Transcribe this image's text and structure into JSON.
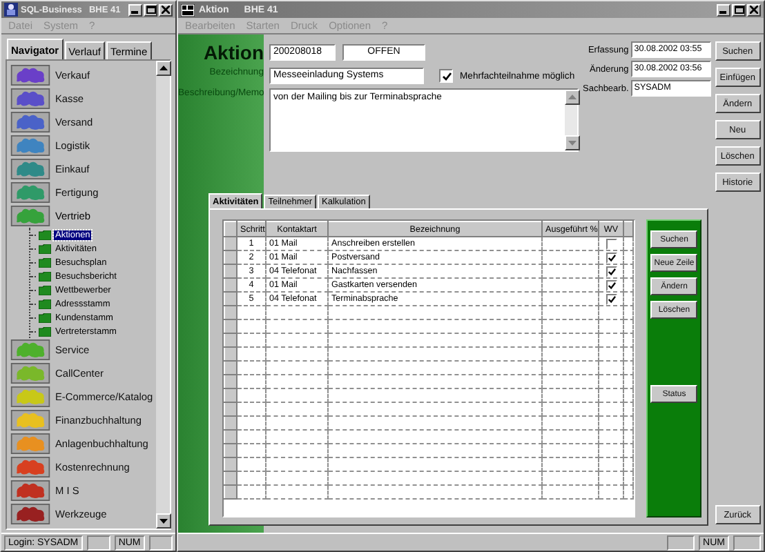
{
  "nav_window": {
    "title": "SQL-Business",
    "title_extra": "BHE 41",
    "menu": [
      "Datei",
      "System",
      "?"
    ],
    "tabs": [
      {
        "label": "Navigator",
        "selected": true
      },
      {
        "label": "Verlauf",
        "selected": false
      },
      {
        "label": "Termine",
        "selected": false
      }
    ],
    "items": [
      {
        "label": "Verkauf",
        "color": "#6a3fc8",
        "expanded": false
      },
      {
        "label": "Kasse",
        "color": "#5a4fc8",
        "expanded": false
      },
      {
        "label": "Versand",
        "color": "#4a62c8",
        "expanded": false
      },
      {
        "label": "Logistik",
        "color": "#3f84c0",
        "expanded": false
      },
      {
        "label": "Einkauf",
        "color": "#2f8a88",
        "expanded": false
      },
      {
        "label": "Fertigung",
        "color": "#2f9a68",
        "expanded": false
      },
      {
        "label": "Vertrieb",
        "color": "#36a23c",
        "expanded": true,
        "children": [
          {
            "label": "Aktionen",
            "selected": true
          },
          {
            "label": "Aktivitäten",
            "selected": false
          },
          {
            "label": "Besuchsplan",
            "selected": false
          },
          {
            "label": "Besuchsbericht",
            "selected": false
          },
          {
            "label": "Wettbewerber",
            "selected": false
          },
          {
            "label": "Adressstamm",
            "selected": false
          },
          {
            "label": "Kundenstamm",
            "selected": false
          },
          {
            "label": "Vertreterstamm",
            "selected": false
          }
        ]
      },
      {
        "label": "Service",
        "color": "#4eb02c",
        "expanded": false
      },
      {
        "label": "CallCenter",
        "color": "#7ab82a",
        "expanded": false
      },
      {
        "label": "E-Commerce/Katalog",
        "color": "#c8c818",
        "expanded": false
      },
      {
        "label": "Finanzbuchhaltung",
        "color": "#e8c020",
        "expanded": false
      },
      {
        "label": "Anlagenbuchhaltung",
        "color": "#e89020",
        "expanded": false
      },
      {
        "label": "Kostenrechnung",
        "color": "#d84020",
        "expanded": false
      },
      {
        "label": "M I S",
        "color": "#c03020",
        "expanded": false
      },
      {
        "label": "Werkzeuge",
        "color": "#982020",
        "expanded": false
      }
    ],
    "status": {
      "login": "Login: SYSADM",
      "num": "NUM"
    }
  },
  "detail_window": {
    "title": "Aktion",
    "title_extra": "BHE 41",
    "menu": [
      "Bearbeiten",
      "Starten",
      "Druck",
      "Optionen",
      "?"
    ],
    "form": {
      "heading": "Aktion",
      "number": "200208018",
      "status": "OFFEN",
      "name_label": "Bezeichnung",
      "name": "Messeeinladung Systems",
      "multi": {
        "label": "Mehrfachteilnahme möglich",
        "checked": true
      },
      "memo_label": "Beschreibung/Memo",
      "memo": "von der Mailing bis zur Terminabsprache",
      "info": [
        {
          "label": "Erfassung",
          "value": "30.08.2002 03:55"
        },
        {
          "label": "Änderung",
          "value": "30.08.2002 03:56"
        },
        {
          "label": "Sachbearb.",
          "value": "SYSADM"
        }
      ]
    },
    "side_buttons": [
      "Suchen",
      "Einfügen",
      "Ändern",
      "Neu",
      "Löschen",
      "Historie"
    ],
    "tabs": [
      {
        "label": "Aktivitäten",
        "selected": true
      },
      {
        "label": "Teilnehmer",
        "selected": false
      },
      {
        "label": "Kalkulation",
        "selected": false
      }
    ],
    "grid": {
      "columns": [
        "Schritt",
        "Kontaktart",
        "Bezeichnung",
        "Ausgeführt %",
        "WV"
      ],
      "rows": [
        {
          "step": "1",
          "contact": "01  Mail",
          "name": "Anschreiben erstellen",
          "wv": false
        },
        {
          "step": "2",
          "contact": "01  Mail",
          "name": "Postversand",
          "wv": true
        },
        {
          "step": "3",
          "contact": "04  Telefonat",
          "name": "Nachfassen",
          "wv": true
        },
        {
          "step": "4",
          "contact": "01  Mail",
          "name": "Gastkarten versenden",
          "wv": true
        },
        {
          "step": "5",
          "contact": "04  Telefonat",
          "name": "Terminabsprache",
          "wv": true
        }
      ]
    },
    "grid_buttons": [
      "Suchen",
      "Neue Zeile",
      "Ändern",
      "Löschen"
    ],
    "status_button": "Status",
    "back_button": "Zurück",
    "status_bar": {
      "num": "NUM"
    }
  }
}
